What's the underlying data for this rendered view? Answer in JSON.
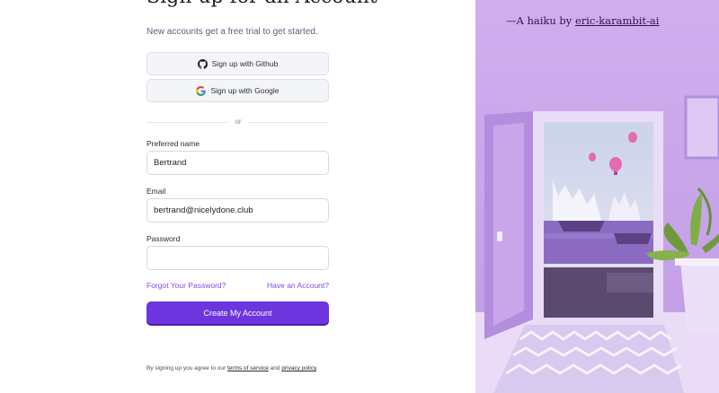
{
  "signup": {
    "title": "Sign up for an Account",
    "subtitle": "New accounts get a free trial to get started.",
    "github_button": "Sign up with Github",
    "google_button": "Sign up with Google",
    "divider": "or",
    "name_label": "Preferred name",
    "name_value": "Bertrand",
    "email_label": "Email",
    "email_value": "bertrand@nicelydone.club",
    "password_label": "Password",
    "password_value": "",
    "forgot_link": "Forgot Your Password?",
    "have_account_link": "Have an Account?",
    "create_button": "Create My Account",
    "legal_prefix": "By signing up you agree to our",
    "terms_link": "terms of service",
    "legal_and": "and",
    "privacy_link": "privacy policy",
    "legal_suffix": "."
  },
  "illustration": {
    "credit_prefix": "—A haiku by",
    "credit_author": "eric-karambit-ai"
  },
  "colors": {
    "primary": "#6d35dd",
    "link": "#7c4ddf",
    "illustration_bg": "#c8a4e8"
  }
}
